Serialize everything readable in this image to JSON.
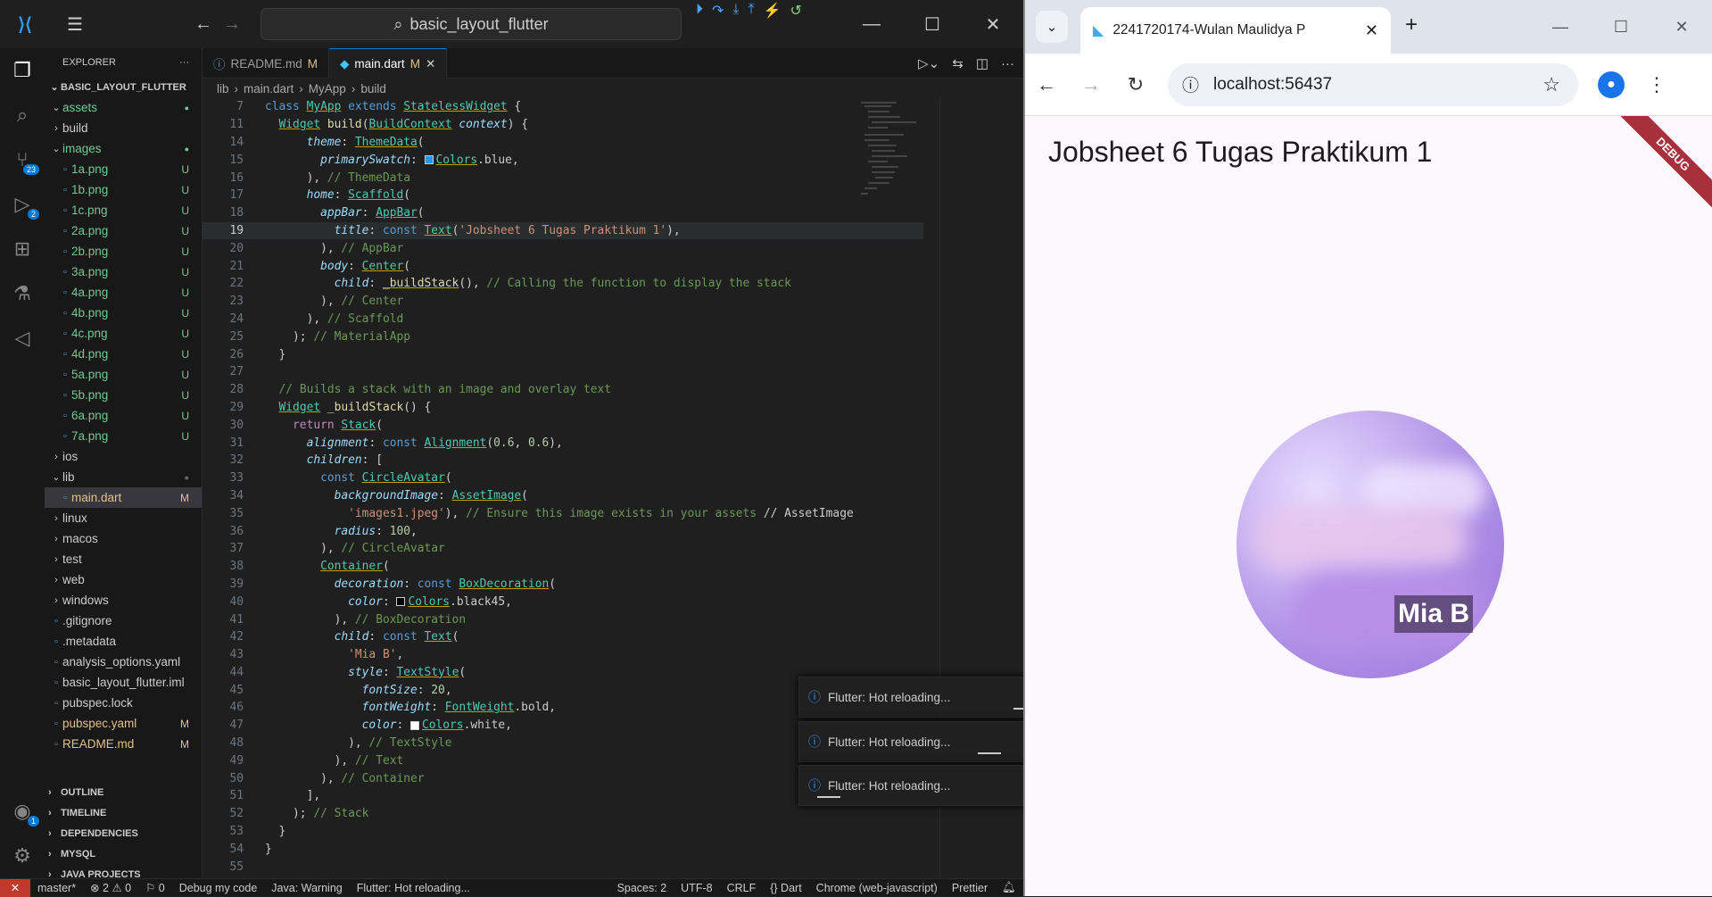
{
  "vscode": {
    "search_text": "basic_layout_flutter",
    "explorer_title": "EXPLORER",
    "project": "BASIC_LAYOUT_FLUTTER",
    "tree": [
      {
        "label": "assets",
        "type": "folder-open",
        "depth": 1,
        "status": "●",
        "status_color": "green"
      },
      {
        "label": "build",
        "type": "folder",
        "depth": 1,
        "status": ""
      },
      {
        "label": "images",
        "type": "folder-open",
        "depth": 1,
        "status": "●",
        "status_color": "green"
      },
      {
        "label": "1a.png",
        "type": "file",
        "depth": 2,
        "status": "U"
      },
      {
        "label": "1b.png",
        "type": "file",
        "depth": 2,
        "status": "U"
      },
      {
        "label": "1c.png",
        "type": "file",
        "depth": 2,
        "status": "U"
      },
      {
        "label": "2a.png",
        "type": "file",
        "depth": 2,
        "status": "U"
      },
      {
        "label": "2b.png",
        "type": "file",
        "depth": 2,
        "status": "U"
      },
      {
        "label": "3a.png",
        "type": "file",
        "depth": 2,
        "status": "U"
      },
      {
        "label": "4a.png",
        "type": "file",
        "depth": 2,
        "status": "U"
      },
      {
        "label": "4b.png",
        "type": "file",
        "depth": 2,
        "status": "U"
      },
      {
        "label": "4c.png",
        "type": "file",
        "depth": 2,
        "status": "U"
      },
      {
        "label": "4d.png",
        "type": "file",
        "depth": 2,
        "status": "U"
      },
      {
        "label": "5a.png",
        "type": "file",
        "depth": 2,
        "status": "U"
      },
      {
        "label": "5b.png",
        "type": "file",
        "depth": 2,
        "status": "U"
      },
      {
        "label": "6a.png",
        "type": "file",
        "depth": 2,
        "status": "U"
      },
      {
        "label": "7a.png",
        "type": "file",
        "depth": 2,
        "status": "U"
      },
      {
        "label": "ios",
        "type": "folder",
        "depth": 1,
        "status": ""
      },
      {
        "label": "lib",
        "type": "folder-open",
        "depth": 1,
        "status": "●",
        "status_color": "dot"
      },
      {
        "label": "main.dart",
        "type": "file",
        "depth": 2,
        "status": "M",
        "selected": true
      },
      {
        "label": "linux",
        "type": "folder",
        "depth": 1,
        "status": ""
      },
      {
        "label": "macos",
        "type": "folder",
        "depth": 1,
        "status": ""
      },
      {
        "label": "test",
        "type": "folder",
        "depth": 1,
        "status": ""
      },
      {
        "label": "web",
        "type": "folder",
        "depth": 1,
        "status": ""
      },
      {
        "label": "windows",
        "type": "folder",
        "depth": 1,
        "status": ""
      },
      {
        "label": ".gitignore",
        "type": "file",
        "depth": 1,
        "status": ""
      },
      {
        "label": ".metadata",
        "type": "file",
        "depth": 1,
        "status": ""
      },
      {
        "label": "analysis_options.yaml",
        "type": "file",
        "depth": 1,
        "status": ""
      },
      {
        "label": "basic_layout_flutter.iml",
        "type": "file",
        "depth": 1,
        "status": ""
      },
      {
        "label": "pubspec.lock",
        "type": "file",
        "depth": 1,
        "status": ""
      },
      {
        "label": "pubspec.yaml",
        "type": "file",
        "depth": 1,
        "status": "M"
      },
      {
        "label": "README.md",
        "type": "file",
        "depth": 1,
        "status": "M"
      }
    ],
    "sections": [
      "OUTLINE",
      "TIMELINE",
      "DEPENDENCIES",
      "MYSQL",
      "JAVA PROJECTS"
    ],
    "tabs": [
      {
        "label": "README.md",
        "status": "M",
        "active": false
      },
      {
        "label": "main.dart",
        "status": "M",
        "active": true
      }
    ],
    "breadcrumb": [
      "lib",
      "main.dart",
      "MyApp",
      "build"
    ],
    "activity_badges": {
      "scm": "23",
      "debug": "2",
      "accounts": "1"
    },
    "code_lines": [
      {
        "no": "7",
        "html": "<span class='kb'>class</span> <span class='c u'>MyApp</span> <span class='kb'>extends</span> <span class='c u'>StatelessWidget</span> {"
      },
      {
        "no": "11",
        "html": "  <span class='c u'>Widget</span> <span class='f'>build</span>(<span class='c u'>BuildContext</span> <span class='p i'>context</span>) {"
      },
      {
        "no": "14",
        "html": "      <span class='p i'>theme</span>: <span class='c u'>ThemeData</span>("
      },
      {
        "no": "15",
        "html": "        <span class='p i'>primarySwatch</span>: <span class='sw' style='background:#2196f3'></span><span class='c u'>Colors</span>.blue,"
      },
      {
        "no": "16",
        "html": "      ), <span class='cm'>// ThemeData</span>"
      },
      {
        "no": "17",
        "html": "      <span class='p i'>home</span>: <span class='c u'>Scaffold</span>("
      },
      {
        "no": "18",
        "html": "        <span class='p i'>appBar</span>: <span class='c u'>AppBar</span>("
      },
      {
        "no": "19",
        "html": "          <span class='p i'>title</span>: <span class='kb'>const</span> <span class='c u'>Text</span>(<span class='s'>'Jobsheet 6 Tugas Praktikum 1'</span>),",
        "current": true
      },
      {
        "no": "20",
        "html": "        ), <span class='cm'>// AppBar</span>"
      },
      {
        "no": "21",
        "html": "        <span class='p i'>body</span>: <span class='c u'>Center</span>("
      },
      {
        "no": "22",
        "html": "          <span class='p i'>child</span>: <span class='f u'>_buildStack</span>(), <span class='cm'>// Calling the function to display the stack</span>"
      },
      {
        "no": "23",
        "html": "        ), <span class='cm'>// Center</span>"
      },
      {
        "no": "24",
        "html": "      ), <span class='cm'>// Scaffold</span>"
      },
      {
        "no": "25",
        "html": "    ); <span class='cm'>// MaterialApp</span>"
      },
      {
        "no": "26",
        "html": "  }"
      },
      {
        "no": "27",
        "html": ""
      },
      {
        "no": "28",
        "html": "  <span class='cm'>// Builds a stack with an image and overlay text</span>"
      },
      {
        "no": "29",
        "html": "  <span class='c u'>Widget</span> <span class='f'>_buildStack</span>() {"
      },
      {
        "no": "30",
        "html": "    <span class='k'>return</span> <span class='c u'>Stack</span>("
      },
      {
        "no": "31",
        "html": "      <span class='p i'>alignment</span>: <span class='kb'>const</span> <span class='c u'>Alignment</span>(<span class='n'>0.6</span>, <span class='n'>0.6</span>),"
      },
      {
        "no": "32",
        "html": "      <span class='p i'>children</span>: ["
      },
      {
        "no": "33",
        "html": "        <span class='kb'>const</span> <span class='c u'>CircleAvatar</span>("
      },
      {
        "no": "34",
        "html": "          <span class='p i'>backgroundImage</span>: <span class='c u'>AssetImage</span>("
      },
      {
        "no": "35",
        "html": "            <span class='s'>'images1.jpeg'</span>), <span class='cm'>// Ensure this image exists in your assets</span> <span class='cm' style='color:#ccc'>// AssetImage</span>"
      },
      {
        "no": "36",
        "html": "          <span class='p i'>radius</span>: <span class='n'>100</span>,"
      },
      {
        "no": "37",
        "html": "        ), <span class='cm'>// CircleAvatar</span>"
      },
      {
        "no": "38",
        "html": "        <span class='c u'>Container</span>("
      },
      {
        "no": "39",
        "html": "          <span class='p i'>decoration</span>: <span class='kb'>const</span> <span class='c u'>BoxDecoration</span>("
      },
      {
        "no": "40",
        "html": "            <span class='p i'>color</span>: <span class='sw' style='background:#000'></span><span class='c u'>Colors</span>.black45,"
      },
      {
        "no": "41",
        "html": "          ), <span class='cm'>// BoxDecoration</span>"
      },
      {
        "no": "42",
        "html": "          <span class='p i'>child</span>: <span class='kb'>const</span> <span class='c u'>Text</span>("
      },
      {
        "no": "43",
        "html": "            <span class='s'>'Mia B'</span>,"
      },
      {
        "no": "44",
        "html": "            <span class='p i'>style</span>: <span class='c u'>TextStyle</span>("
      },
      {
        "no": "45",
        "html": "              <span class='p i'>fontSize</span>: <span class='n'>20</span>,"
      },
      {
        "no": "46",
        "html": "              <span class='p i'>fontWeight</span>: <span class='c u'>FontWeight</span>.bold,"
      },
      {
        "no": "47",
        "html": "              <span class='p i'>color</span>: <span class='sw' style='background:#fff'></span><span class='c u'>Colors</span>.white,"
      },
      {
        "no": "48",
        "html": "            ), <span class='cm'>// TextStyle</span>"
      },
      {
        "no": "49",
        "html": "          ), <span class='cm'>// Text</span>"
      },
      {
        "no": "50",
        "html": "        ), <span class='cm'>// Container</span>"
      },
      {
        "no": "51",
        "html": "      ],"
      },
      {
        "no": "52",
        "html": "    ); <span class='cm'>// Stack</span>"
      },
      {
        "no": "53",
        "html": "  }"
      },
      {
        "no": "54",
        "html": "}"
      },
      {
        "no": "55",
        "html": ""
      }
    ],
    "toasts": [
      "Flutter: Hot reloading...",
      "Flutter: Hot reloading...",
      "Flutter: Hot reloading..."
    ],
    "status": {
      "branch": "master*",
      "problems": "⊗ 2 ⚠ 0",
      "ports": "⚐ 0",
      "debug": "Debug my code",
      "java": "Java: Warning",
      "flutter": "Flutter: Hot reloading...",
      "spaces": "Spaces: 2",
      "encoding": "UTF-8",
      "eol": "CRLF",
      "lang": "{} Dart",
      "device": "Chrome (web-javascript)",
      "prettier": "Prettier"
    }
  },
  "browser": {
    "tab_title": "2241720174-Wulan Maulidya P",
    "url": "localhost:56437",
    "app_title": "Jobsheet 6 Tugas Praktikum 1",
    "debug_banner": "DEBUG",
    "overlay_text": "Mia B"
  }
}
